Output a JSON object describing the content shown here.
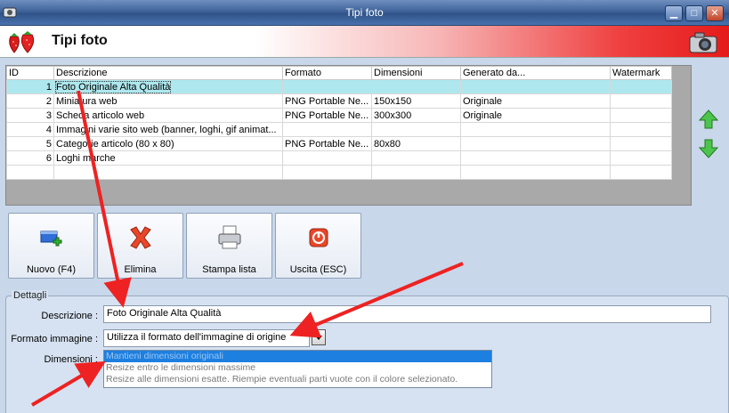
{
  "window": {
    "title": "Tipi foto",
    "controls": {
      "minimize": "▁",
      "maximize": "□",
      "close": "✕"
    }
  },
  "header": {
    "title": "Tipi foto",
    "logo_icon": "strawberry-icon",
    "right_icon": "camera-icon"
  },
  "grid": {
    "columns": [
      "ID",
      "Descrizione",
      "Formato",
      "Dimensioni",
      "Generato da...",
      "Watermark"
    ],
    "rows": [
      {
        "id": "1",
        "descrizione": "Foto Originale Alta Qualità",
        "formato": "",
        "dimensioni": "",
        "generato": "",
        "watermark": ""
      },
      {
        "id": "2",
        "descrizione": "Miniatura web",
        "formato": "PNG Portable Ne...",
        "dimensioni": "150x150",
        "generato": "Originale",
        "watermark": ""
      },
      {
        "id": "3",
        "descrizione": "Scheda articolo web",
        "formato": "PNG Portable Ne...",
        "dimensioni": "300x300",
        "generato": "Originale",
        "watermark": ""
      },
      {
        "id": "4",
        "descrizione": "Immagini varie sito web (banner, loghi, gif animat...",
        "formato": "",
        "dimensioni": "",
        "generato": "",
        "watermark": ""
      },
      {
        "id": "5",
        "descrizione": "Categorie articolo (80 x 80)",
        "formato": "PNG Portable Ne...",
        "dimensioni": "80x80",
        "generato": "",
        "watermark": ""
      },
      {
        "id": "6",
        "descrizione": "Loghi marche",
        "formato": "",
        "dimensioni": "",
        "generato": "",
        "watermark": ""
      }
    ]
  },
  "toolbar": {
    "new_label": "Nuovo (F4)",
    "delete_label": "Elimina",
    "print_label": "Stampa lista",
    "exit_label": "Uscita (ESC)"
  },
  "details": {
    "legend": "Dettagli",
    "descrizione_label": "Descrizione :",
    "descrizione_value": "Foto Originale Alta Qualità",
    "formato_label": "Formato immagine :",
    "formato_value": "Utilizza il formato dell'immagine di origine",
    "dimensioni_label": "Dimensioni :",
    "dimensioni_options": [
      "Mantieni dimensioni originali",
      "Resize entro le dimensioni massime",
      "Resize alle dimensioni esatte. Riempie eventuali parti vuote con il colore selezionato."
    ]
  },
  "colors": {
    "selected_row": "#aee8ee",
    "annotation_arrow": "#ee2222",
    "list_highlight": "#1d7fe0"
  }
}
